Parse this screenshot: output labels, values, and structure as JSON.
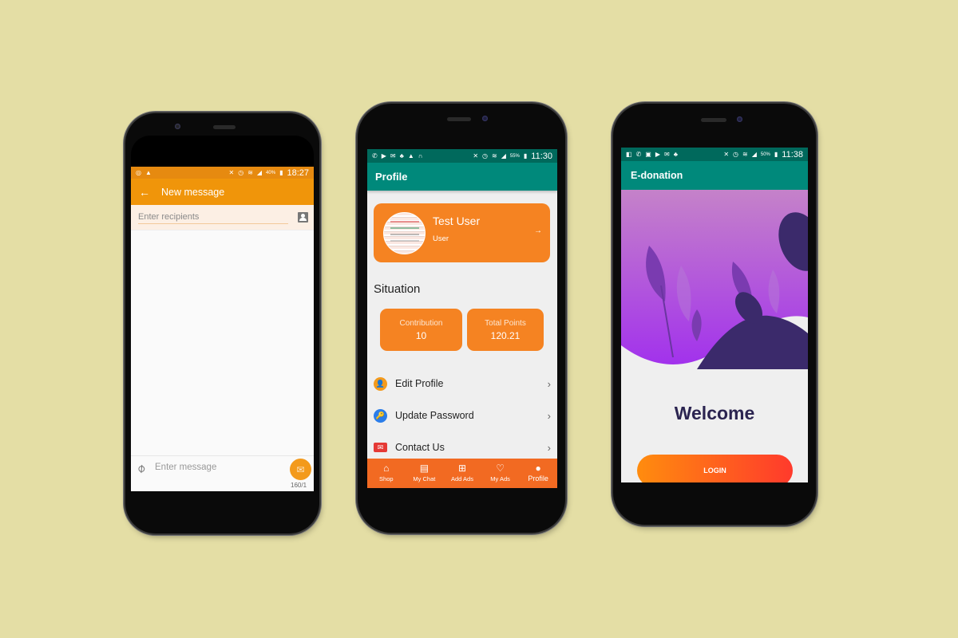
{
  "background_color": "#e4dea5",
  "phone_sms": {
    "status_bar": {
      "left_icons": [
        "whatsapp-icon",
        "warning-icon"
      ],
      "right_icons": [
        "mute-icon",
        "alarm-icon",
        "wifi-icon",
        "signal-icon"
      ],
      "battery": "40%",
      "time": "18:27",
      "color": "#e68a10"
    },
    "app_bar": {
      "title": "New message",
      "back_icon": "←",
      "color": "#f0950a"
    },
    "recipients": {
      "placeholder": "Enter recipients"
    },
    "compose": {
      "placeholder": "Enter message",
      "char_count": "160/1",
      "send_icon": "✉"
    }
  },
  "phone_profile": {
    "status_bar": {
      "left_icons": [
        "phone-icon",
        "youtube-icon",
        "mail-icon",
        "incognito-icon",
        "warning-icon",
        "headset-icon"
      ],
      "right_icons": [
        "mute-icon",
        "alarm-icon",
        "wifi-icon",
        "signal-icon"
      ],
      "battery": "55%",
      "time": "11:30"
    },
    "app_bar": {
      "title": "Profile",
      "color": "#00897b"
    },
    "user_card": {
      "name": "Test User",
      "role": "User",
      "arrow": "→"
    },
    "section_title": "Situation",
    "stats": [
      {
        "label": "Contribution",
        "value": "10"
      },
      {
        "label": "Total Points",
        "value": "120.21"
      }
    ],
    "menu": [
      {
        "label": "Edit Profile",
        "icon": "person-icon",
        "icon_color": "#f39a1c",
        "glyph": "👤"
      },
      {
        "label": "Update Password",
        "icon": "key-icon",
        "icon_color": "#2b7de9",
        "glyph": "🔑"
      },
      {
        "label": "Contact Us",
        "icon": "mail-icon",
        "icon_color": "#e53935",
        "glyph": "✉"
      }
    ],
    "bottom_nav": [
      {
        "label": "Shop",
        "glyph": "⌂",
        "icon": "home-icon"
      },
      {
        "label": "My Chat",
        "glyph": "▤",
        "icon": "chat-icon"
      },
      {
        "label": "Add Ads",
        "glyph": "⊞",
        "icon": "add-ad-icon"
      },
      {
        "label": "My Ads",
        "glyph": "♡",
        "icon": "heart-icon"
      },
      {
        "label": "Profile",
        "glyph": "●",
        "icon": "person-icon",
        "active": true
      }
    ]
  },
  "phone_edonation": {
    "status_bar": {
      "left_icons": [
        "tag-icon",
        "phone-icon",
        "gallery-icon",
        "youtube-icon",
        "mail-icon",
        "incognito-icon"
      ],
      "right_icons": [
        "mute-icon",
        "alarm-icon",
        "wifi-icon",
        "signal-icon"
      ],
      "battery": "50%",
      "time": "11:38"
    },
    "app_bar": {
      "title": "E-donation"
    },
    "welcome": "Welcome",
    "login_button": "LOGIN"
  }
}
